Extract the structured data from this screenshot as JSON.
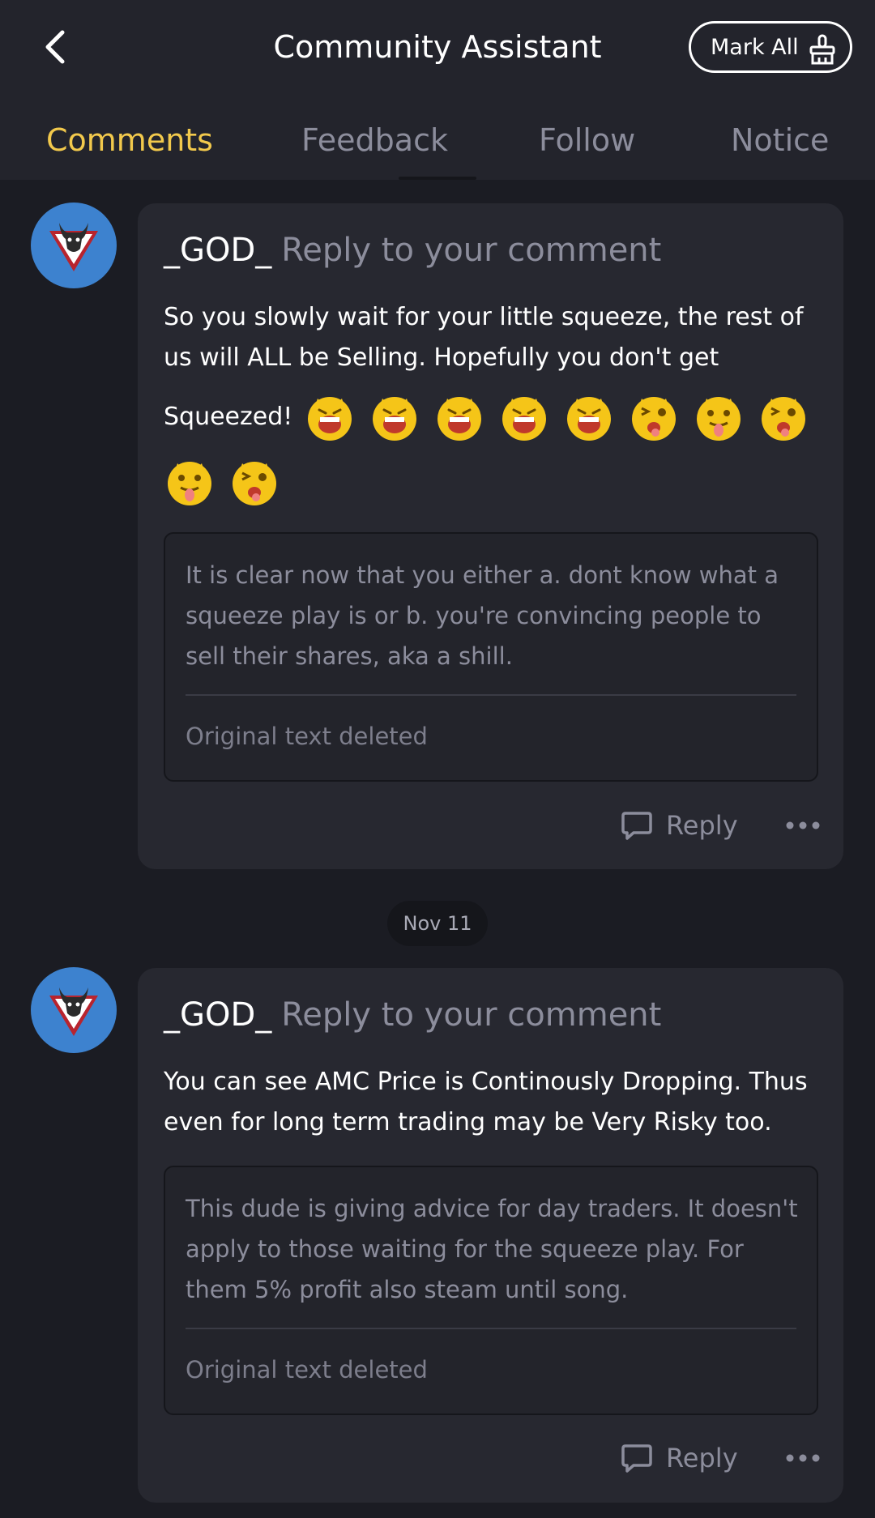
{
  "header": {
    "title": "Community Assistant",
    "mark_all_label": "Mark All"
  },
  "tabs": [
    {
      "label": "Comments",
      "active": true
    },
    {
      "label": "Feedback",
      "active": false
    },
    {
      "label": "Follow",
      "active": false
    },
    {
      "label": "Notice",
      "active": false
    }
  ],
  "colors": {
    "accent": "#f2c94c",
    "avatar_bg": "#3d82cf",
    "background": "#1b1c23",
    "card": "#272830"
  },
  "notifications": [
    {
      "user": "_GOD_",
      "action": "Reply to your comment",
      "message_lines": [
        "So you slowly wait for your little squeeze, the rest of us will ALL be Selling. Hopefully you don't get"
      ],
      "message_tail": "Squeezed!",
      "emojis": [
        "laughing-tiger-emoji",
        "laughing-tiger-emoji",
        "laughing-tiger-emoji",
        "laughing-tiger-emoji",
        "laughing-tiger-emoji",
        "winking-tiger-emoji",
        "tongue-tiger-emoji",
        "winking-tiger-emoji",
        "tongue-tiger-emoji",
        "winking-tiger-emoji"
      ],
      "quote": "It is clear now that you either a. dont know what a squeeze play is or b. you're convincing people to sell their shares, aka a shill.",
      "quote_footer": "Original text deleted",
      "reply_label": "Reply"
    },
    {
      "user": "_GOD_",
      "action": "Reply to your comment",
      "message": "You can see AMC Price is Continously Dropping. Thus even for long term trading may be Very Risky too.",
      "quote": "This dude is giving advice for day traders. It doesn't apply to those waiting for the squeeze play. For them 5% profit also steam until song.",
      "quote_footer": "Original text deleted",
      "reply_label": "Reply"
    }
  ],
  "date_separator": "Nov 11"
}
